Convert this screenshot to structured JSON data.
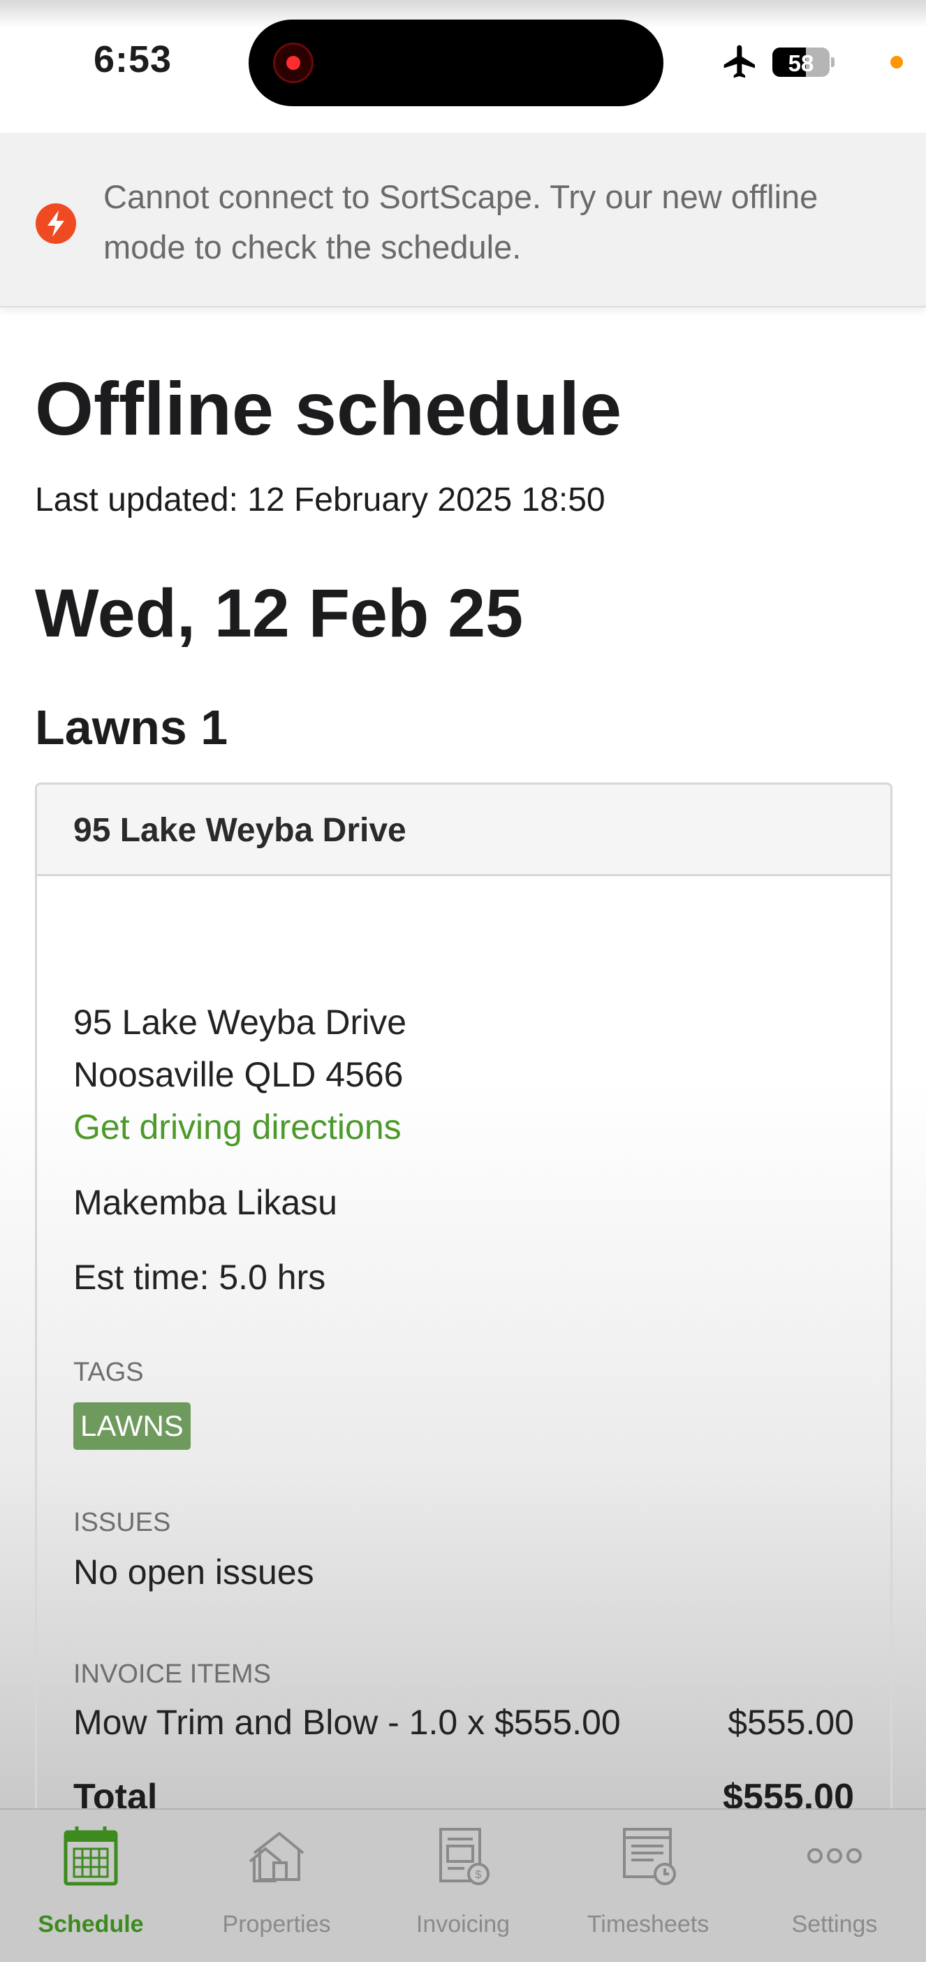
{
  "status_bar": {
    "time": "6:53",
    "battery": "58",
    "battery_level": 0.58,
    "icons": [
      "airplane-icon",
      "battery-icon",
      "recording-indicator-icon"
    ]
  },
  "banner": {
    "icon": "lightning-bolt-icon",
    "message": "Cannot connect to SortScape. Try our new offline mode to check the schedule."
  },
  "page": {
    "title": "Offline schedule",
    "last_updated": "Last updated: 12 February 2025 18:50",
    "day": "Wed, 12 Feb 25",
    "group": "Lawns 1"
  },
  "job": {
    "title": "95 Lake Weyba Drive",
    "address_line1": "95 Lake Weyba Drive",
    "address_line2": "Noosaville QLD 4566",
    "directions_label": "Get driving directions",
    "client": "Makemba Likasu",
    "est_time": "Est time: 5.0 hrs",
    "tags_label": "TAGS",
    "tags": [
      "LAWNS"
    ],
    "issues_label": "ISSUES",
    "issues_value": "No open issues",
    "invoice_label": "INVOICE ITEMS",
    "invoice_items": [
      {
        "description": "Mow Trim and Blow - 1.0 x $555.00",
        "amount": "$555.00"
      }
    ],
    "total_label": "Total",
    "total_value": "$555.00"
  },
  "tabs": [
    {
      "label": "Schedule",
      "icon": "calendar-icon",
      "active": true
    },
    {
      "label": "Properties",
      "icon": "house-icon",
      "active": false
    },
    {
      "label": "Invoicing",
      "icon": "invoice-icon",
      "active": false
    },
    {
      "label": "Timesheets",
      "icon": "timesheet-icon",
      "active": false
    },
    {
      "label": "Settings",
      "icon": "more-dots-icon",
      "active": false
    }
  ],
  "colors": {
    "accent_green": "#3d8b1e",
    "link_green": "#4c9a2a",
    "tag_green": "#6f9a5d",
    "alert_orange": "#f04a23"
  }
}
